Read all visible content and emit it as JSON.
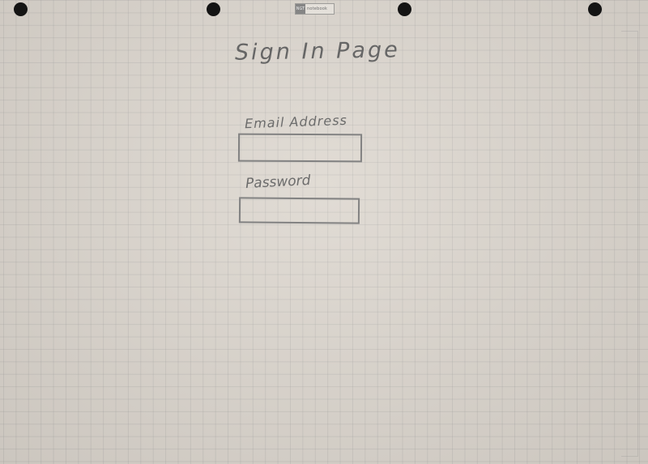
{
  "page": {
    "title": "Sign In Page"
  },
  "form": {
    "email_label": "Email Address",
    "email_value": "",
    "password_label": "Password",
    "password_value": ""
  },
  "notebook": {
    "logo_mark": "NGT",
    "logo_text": "notebook"
  },
  "colors": {
    "paper": "#ddd7cf",
    "ink": "#6b6b6b",
    "hole": "#141414"
  }
}
